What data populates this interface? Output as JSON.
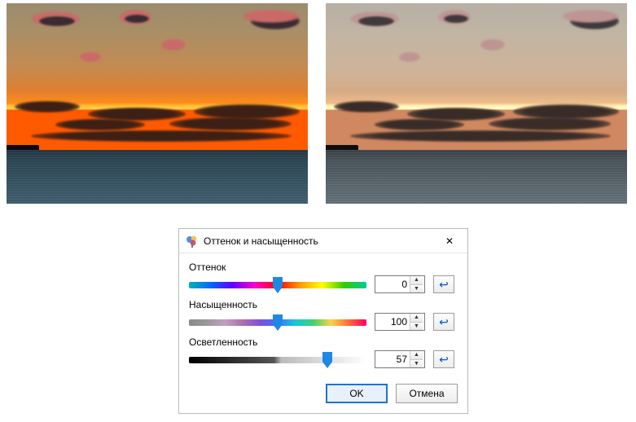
{
  "dialog": {
    "title": "Оттенок и насыщенность",
    "hue": {
      "label": "Оттенок",
      "value": "0",
      "min": -180,
      "max": 180,
      "thumb_pct": 50
    },
    "saturation": {
      "label": "Насыщенность",
      "value": "100",
      "min": 0,
      "max": 200,
      "thumb_pct": 50
    },
    "lightness": {
      "label": "Осветленность",
      "value": "57",
      "min": -100,
      "max": 100,
      "thumb_pct": 78
    },
    "ok_label": "OK",
    "cancel_label": "Отмена"
  },
  "icons": {
    "close": "✕",
    "reset": "↩",
    "spin_up": "▲",
    "spin_down": "▼"
  }
}
